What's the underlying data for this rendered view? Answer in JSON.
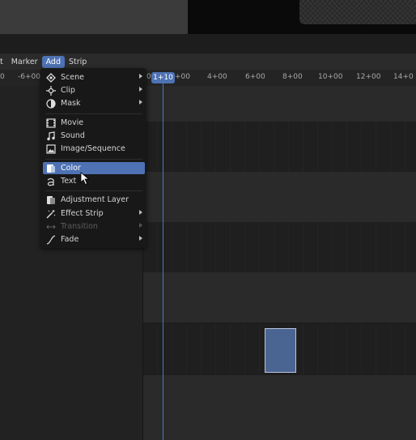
{
  "menubar": {
    "items": [
      "t",
      "Marker",
      "Add",
      "Strip"
    ],
    "active_index": 2
  },
  "ruler": {
    "left_labels": [
      "0",
      "-6+00"
    ],
    "playhead_label": "1+10",
    "right_labels": [
      "+00",
      "4+00",
      "6+00",
      "8+00",
      "10+00",
      "12+00",
      "14+0"
    ]
  },
  "add_menu": {
    "items": [
      {
        "label": "Scene",
        "icon": "scene-icon",
        "submenu": true
      },
      {
        "label": "Clip",
        "icon": "clip-icon",
        "submenu": true
      },
      {
        "label": "Mask",
        "icon": "mask-icon",
        "submenu": true
      },
      {
        "label": "Movie",
        "icon": "movie-icon",
        "submenu": false
      },
      {
        "label": "Sound",
        "icon": "sound-icon",
        "submenu": false
      },
      {
        "label": "Image/Sequence",
        "icon": "image-icon",
        "submenu": false
      },
      {
        "label": "Color",
        "icon": "color-icon",
        "submenu": false,
        "highlighted": true
      },
      {
        "label": "Text",
        "icon": "text-icon",
        "submenu": false
      },
      {
        "label": "Adjustment Layer",
        "icon": "adjustment-layer-icon",
        "submenu": false
      },
      {
        "label": "Effect Strip",
        "icon": "effect-strip-icon",
        "submenu": true
      },
      {
        "label": "Transition",
        "icon": "transition-icon",
        "submenu": true,
        "disabled": true
      },
      {
        "label": "Fade",
        "icon": "fade-icon",
        "submenu": true
      }
    ]
  },
  "colors": {
    "accent": "#4e72b3",
    "strip": "#4a6591",
    "playhead": "#4c79c4"
  }
}
